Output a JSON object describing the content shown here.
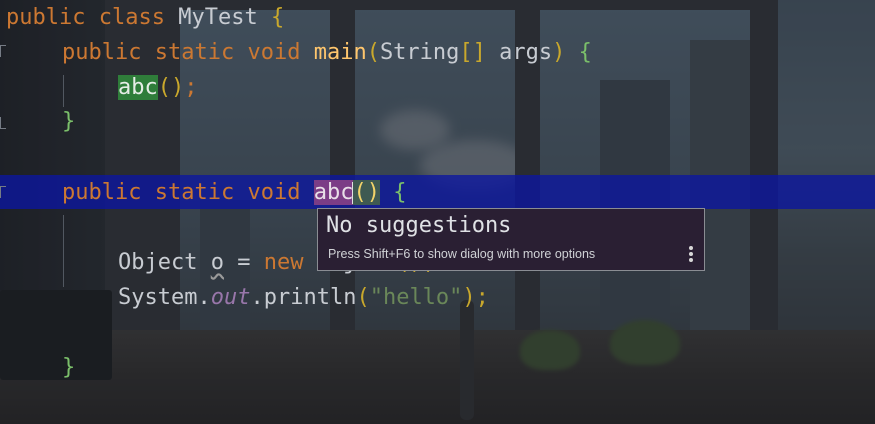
{
  "editor": {
    "lines": [
      {
        "tokens": [
          "public",
          " ",
          "class",
          " ",
          "MyTest",
          " ",
          "{"
        ]
      },
      {
        "tokens": [
          "public",
          " ",
          "static",
          " ",
          "void",
          " ",
          "main",
          "(",
          "String",
          "[]",
          " ",
          "args",
          ")",
          " ",
          "{"
        ]
      },
      {
        "tokens": [
          "abc",
          "()",
          ";"
        ]
      },
      {
        "tokens": [
          "}"
        ]
      },
      {
        "tokens": [
          "public",
          " ",
          "static",
          " ",
          "void",
          " ",
          "abc",
          "()",
          " ",
          "{"
        ]
      },
      {
        "tokens": [
          "Object",
          " ",
          "o",
          " ",
          "=",
          " ",
          "new",
          " ",
          "Object",
          "();"
        ]
      },
      {
        "tokens": [
          "System",
          ".",
          "out",
          ".",
          "println",
          "(",
          "\"hello\"",
          ");"
        ]
      },
      {
        "tokens": [
          "}"
        ]
      }
    ]
  },
  "popup": {
    "title": "No suggestions",
    "hint": "Press Shift+F6 to show dialog with more options",
    "more_icon": "more-vertical-icon"
  },
  "colors": {
    "keyword": "#cc7832",
    "method": "#ffc66d",
    "string": "#6a8759",
    "static_field": "#9876aa",
    "selection": "#0c16a0",
    "rename_highlight": "#7b3d86",
    "call_highlight": "#2f7d3a"
  }
}
